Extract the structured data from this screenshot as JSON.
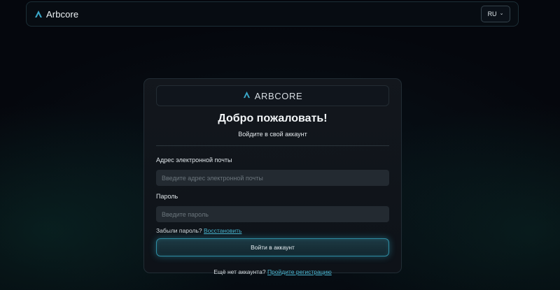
{
  "navbar": {
    "brand_name": "Arbcore",
    "logo_icon": "arbcore-logo-icon",
    "language": "RU",
    "language_icon": "chevron-down-icon"
  },
  "card": {
    "logo_text": "ARBCORE",
    "title": "Добро пожаловать!",
    "subtitle": "Войдите в свой аккаунт",
    "email_label": "Адрес электронной почты",
    "email_placeholder": "Введите адрес электронной почты",
    "email_value": "",
    "password_label": "Пароль",
    "password_placeholder": "Введите пароль",
    "password_value": "",
    "forgot_text": "Забыли пароль?",
    "restore_link": "Восстановить",
    "submit_label": "Войти в аккаунт",
    "no_account_text": "Ещё нет аккаунта?",
    "register_link": "Пройдите регистрацию"
  },
  "colors": {
    "accent": "#4ab7d2",
    "logo": "#3aa7c8",
    "background": "#05070d"
  }
}
